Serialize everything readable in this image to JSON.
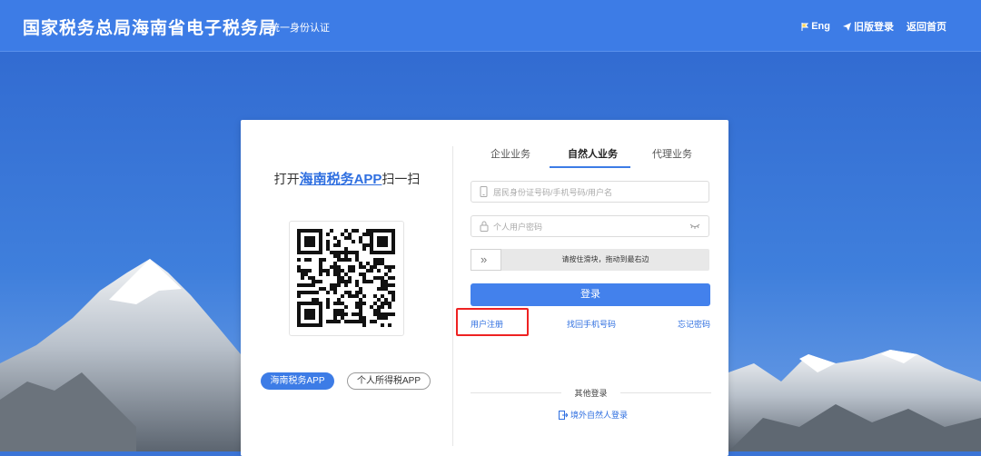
{
  "header": {
    "title": "国家税务总局海南省电子税务局",
    "subtitle": "统一身份认证",
    "nav": {
      "lang": "Eng",
      "old_login": "旧版登录",
      "home": "返回首页"
    }
  },
  "left": {
    "scan_prefix": "打开",
    "scan_app": "海南税务APP",
    "scan_suffix": "扫一扫",
    "app_buttons": [
      "海南税务APP",
      "个人所得税APP"
    ]
  },
  "tabs": [
    "企业业务",
    "自然人业务",
    "代理业务"
  ],
  "active_tab": "自然人业务",
  "form": {
    "id_placeholder": "居民身份证号码/手机号码/用户名",
    "password_placeholder": "个人用户密码",
    "slider_text": "请按住滑块，拖动到最右边",
    "slider_icon": "double-chevron-right-icon",
    "login_label": "登录"
  },
  "links": {
    "register": "用户注册",
    "recover_phone": "找回手机号码",
    "forgot_password": "忘记密码"
  },
  "other": {
    "label": "其他登录",
    "overseas": "境外自然人登录"
  },
  "colors": {
    "header": "#3d7ce6",
    "primary": "#4381ec",
    "link": "#2f6fe0",
    "highlight_box": "#e22222"
  }
}
